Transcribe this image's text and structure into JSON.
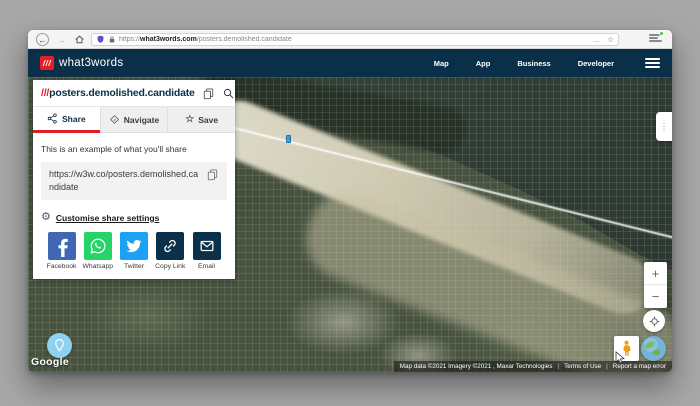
{
  "browser": {
    "back": "←",
    "forward": "→",
    "url_scheme": "https://",
    "url_domain": "what3words.com",
    "url_path": "/posters.demolished.candidate",
    "overflow_menu": "…",
    "bookmark_star": "☆"
  },
  "header": {
    "logo_slashes": "///",
    "logo_text": "what3words",
    "nav": [
      {
        "label": "Map"
      },
      {
        "label": "App"
      },
      {
        "label": "Business"
      },
      {
        "label": "Developer"
      }
    ]
  },
  "panel": {
    "address_prefix": "///",
    "address": "posters.demolished.candidate",
    "tabs": [
      {
        "label": "Share"
      },
      {
        "label": "Navigate"
      },
      {
        "label": "Save"
      }
    ],
    "active_tab": "Share",
    "example_text": "This is an example of what you'll share",
    "share_url": "https://w3w.co/posters.demolished.candidate",
    "customise_link": "Customise share settings",
    "share_buttons": [
      {
        "label": "Facebook",
        "color": "#4267b2"
      },
      {
        "label": "Whatsapp",
        "color": "#25d366"
      },
      {
        "label": "Twitter",
        "color": "#1da1f2"
      },
      {
        "label": "Copy Link",
        "color": "#0b3049"
      },
      {
        "label": "Email",
        "color": "#0b3049"
      }
    ]
  },
  "map": {
    "dots_button": "⋮",
    "zoom_in": "+",
    "zoom_out": "−",
    "google_logo": "Google",
    "attribution": "Map data ©2021 Imagery ©2021 , Maxar Technologies",
    "terms_of_use": "Terms of Use",
    "report_error": "Report a map error"
  },
  "colors": {
    "brand_navy": "#0a3049",
    "brand_red": "#e11f26",
    "facebook": "#4267b2",
    "whatsapp": "#25d366",
    "twitter": "#1da1f2"
  }
}
